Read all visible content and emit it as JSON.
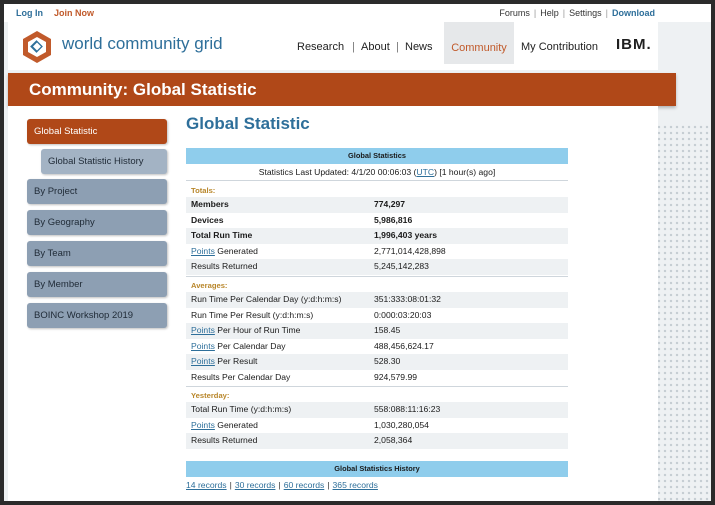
{
  "topbar": {
    "login": "Log In",
    "join": "Join Now",
    "links": [
      "Forums",
      "Help",
      "Settings"
    ],
    "download": "Download"
  },
  "header": {
    "logo_text": "world community grid",
    "nav": [
      "Research",
      "About",
      "News"
    ],
    "nav_active": "Community",
    "nav_extra": "My Contribution",
    "ibm": "IBM."
  },
  "banner": {
    "title": "Community:  Global Statistic"
  },
  "sidebar": {
    "items": [
      {
        "label": "Global Statistic"
      },
      {
        "label": "Global Statistic History"
      },
      {
        "label": "By Project"
      },
      {
        "label": "By Geography"
      },
      {
        "label": "By Team"
      },
      {
        "label": "By Member"
      },
      {
        "label": "BOINC Workshop 2019"
      }
    ]
  },
  "page": {
    "title": "Global Statistic"
  },
  "stats": {
    "header": "Global Statistics",
    "updated_prefix": "Statistics Last Updated: 4/1/20 00:06:03 (",
    "updated_link": "UTC",
    "updated_suffix": ") [1 hour(s) ago]",
    "totals_label": "Totals:",
    "totals": [
      {
        "key": "Members",
        "value": "774,297"
      },
      {
        "key": "Devices",
        "value": "5,986,816"
      },
      {
        "key": "Total Run Time",
        "value": "1,996,403 years"
      },
      {
        "key_link": "Points",
        "key_rest": " Generated",
        "value": "2,771,014,428,898"
      },
      {
        "key": "Results Returned",
        "value": "5,245,142,283"
      }
    ],
    "averages_label": "Averages:",
    "averages": [
      {
        "key": "Run Time Per Calendar Day (y:d:h:m:s)",
        "value": "351:333:08:01:32"
      },
      {
        "key": "Run Time Per Result (y:d:h:m:s)",
        "value": "0:000:03:20:03"
      },
      {
        "key_link": "Points",
        "key_rest": " Per Hour of Run Time",
        "value": "158.45"
      },
      {
        "key_link": "Points",
        "key_rest": " Per Calendar Day",
        "value": "488,456,624.17"
      },
      {
        "key_link": "Points",
        "key_rest": " Per Result",
        "value": "528.30"
      },
      {
        "key": "Results Per Calendar Day",
        "value": "924,579.99"
      }
    ],
    "yesterday_label": "Yesterday:",
    "yesterday": [
      {
        "key": "Total Run Time (y:d:h:m:s)",
        "value": "558:088:11:16:23"
      },
      {
        "key_link": "Points",
        "key_rest": " Generated",
        "value": "1,030,280,054"
      },
      {
        "key": "Results Returned",
        "value": "2,058,364"
      }
    ]
  },
  "history": {
    "header": "Global Statistics History",
    "links": [
      "14 records",
      "30 records",
      "60 records",
      "365 records"
    ]
  }
}
